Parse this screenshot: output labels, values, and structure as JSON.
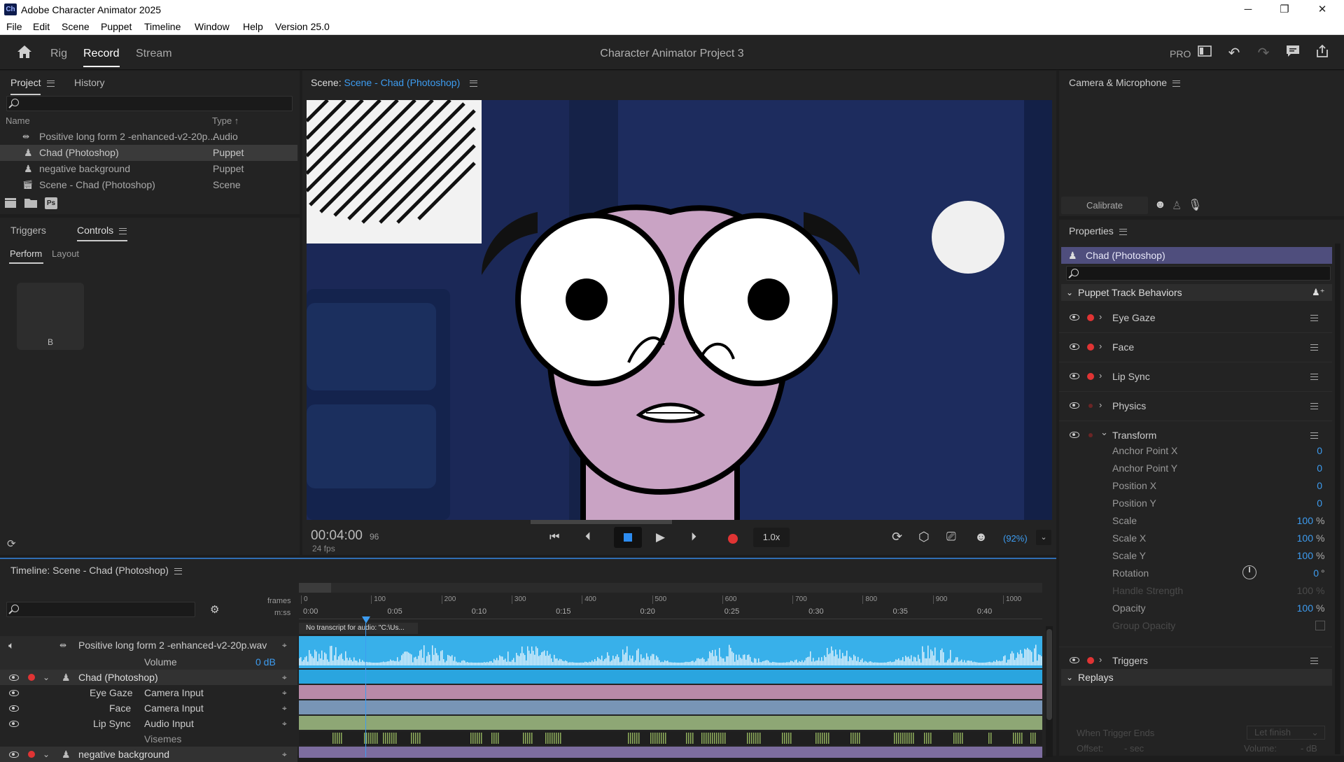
{
  "app": {
    "title": "Adobe Character Animator 2025",
    "logo": "Ch",
    "window_controls": {
      "minimize": "─",
      "maximize": "❐",
      "close": "✕"
    }
  },
  "menu": [
    "File",
    "Edit",
    "Scene",
    "Puppet",
    "Timeline",
    "Window",
    "Help",
    "Version 25.0"
  ],
  "toolbar": {
    "home_icon": "home-icon",
    "tabs": [
      "Rig",
      "Record",
      "Stream"
    ],
    "active_tab": "Record",
    "project_title": "Character Animator Project 3",
    "pro_label": "PRO"
  },
  "project_panel": {
    "tabs": [
      "Project",
      "History"
    ],
    "columns": {
      "name": "Name",
      "type": "Type ↑"
    },
    "items": [
      {
        "name": "Positive long form 2 -enhanced-v2-20p...",
        "type": "Audio",
        "icon": "audio-icon"
      },
      {
        "name": "Chad (Photoshop)",
        "type": "Puppet",
        "icon": "puppet-icon"
      },
      {
        "name": "negative background",
        "type": "Puppet",
        "icon": "puppet-icon"
      },
      {
        "name": "Scene - Chad (Photoshop)",
        "type": "Scene",
        "icon": "scene-icon"
      }
    ],
    "footer_ps": "Ps"
  },
  "controls_panel": {
    "tabs": [
      "Triggers",
      "Controls"
    ],
    "subtabs": [
      "Perform",
      "Layout"
    ],
    "button_label": "B"
  },
  "scene_panel": {
    "label": "Scene:",
    "scene_name": "Scene - Chad (Photoshop)",
    "timecode": "00:04:00",
    "frame": "96",
    "fps": "24 fps",
    "speed": "1.0x",
    "zoom": "(92%)"
  },
  "camera_panel": {
    "title": "Camera & Microphone",
    "calibrate": "Calibrate"
  },
  "properties_panel": {
    "title": "Properties",
    "puppet": "Chad (Photoshop)",
    "section": "Puppet Track Behaviors",
    "behaviors": [
      "Eye Gaze",
      "Face",
      "Lip Sync",
      "Physics",
      "Transform"
    ],
    "transform_props": [
      {
        "name": "Anchor Point X",
        "value": "0",
        "unit": ""
      },
      {
        "name": "Anchor Point Y",
        "value": "0",
        "unit": ""
      },
      {
        "name": "Position X",
        "value": "0",
        "unit": ""
      },
      {
        "name": "Position Y",
        "value": "0",
        "unit": ""
      },
      {
        "name": "Scale",
        "value": "100",
        "unit": "%"
      },
      {
        "name": "Scale X",
        "value": "100",
        "unit": "%"
      },
      {
        "name": "Scale Y",
        "value": "100",
        "unit": "%"
      },
      {
        "name": "Rotation",
        "value": "0",
        "unit": "°"
      },
      {
        "name": "Handle Strength",
        "value": "100",
        "unit": "%"
      },
      {
        "name": "Opacity",
        "value": "100",
        "unit": "%"
      },
      {
        "name": "Group Opacity",
        "value": "",
        "unit": ""
      }
    ],
    "triggers": "Triggers",
    "replays": "Replays",
    "when_trigger_ends": "When Trigger Ends",
    "let_finish": "Let finish",
    "offset": "Offset:",
    "offset_val": "- sec",
    "volume": "Volume:",
    "volume_val": "- dB"
  },
  "timeline": {
    "title": "Timeline: Scene - Chad (Photoshop)",
    "frames_label": "frames",
    "mss_label": "m:ss",
    "frame_ticks": [
      "0",
      "100",
      "200",
      "300",
      "400",
      "500",
      "600",
      "700",
      "800",
      "900",
      "1000"
    ],
    "time_ticks": [
      "0:00",
      "0:05",
      "0:10",
      "0:15",
      "0:20",
      "0:25",
      "0:30",
      "0:35",
      "0:40"
    ],
    "transcript_note": "No transcript for audio: \"C:\\Us...",
    "rows": [
      {
        "label": "Positive long form 2 -enhanced-v2-20p.wav"
      },
      {
        "label": "Volume",
        "value": "0 dB"
      },
      {
        "label": "Chad (Photoshop)"
      },
      {
        "label": "Eye Gaze",
        "value": "Camera Input"
      },
      {
        "label": "Face",
        "value": "Camera Input"
      },
      {
        "label": "Lip Sync",
        "value": "Audio Input"
      },
      {
        "label": "Visemes"
      },
      {
        "label": "negative background"
      }
    ]
  }
}
